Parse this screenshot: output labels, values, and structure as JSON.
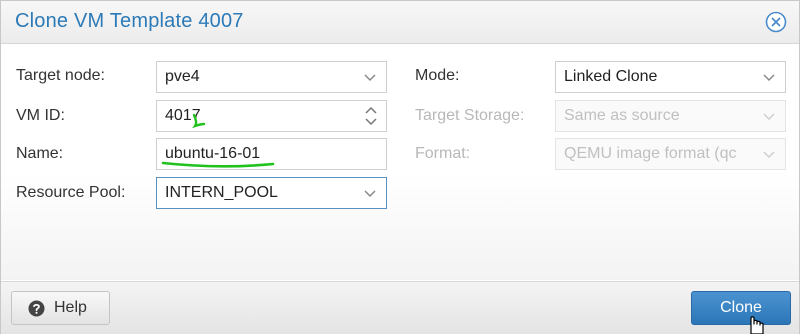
{
  "dialog": {
    "title": "Clone VM Template 4007"
  },
  "form_left": {
    "target_node": {
      "label": "Target node:",
      "value": "pve4"
    },
    "vm_id": {
      "label": "VM ID:",
      "value": "4017"
    },
    "name": {
      "label": "Name:",
      "value": "ubuntu-16-01"
    },
    "resource_pool": {
      "label": "Resource Pool:",
      "value": "INTERN_POOL"
    }
  },
  "form_right": {
    "mode": {
      "label": "Mode:",
      "value": "Linked Clone"
    },
    "target_storage": {
      "label": "Target Storage:",
      "value": "Same as source"
    },
    "format": {
      "label": "Format:",
      "value": "QEMU image format (qc"
    }
  },
  "footer": {
    "help_label": "Help",
    "clone_label": "Clone"
  },
  "colors": {
    "title": "#2c7ab7",
    "primary_button": "#2c76b8",
    "annotation_ink": "#22c21e"
  },
  "icons": {
    "close": "close-circle-icon",
    "help": "question-circle-icon",
    "dropdown": "chevron-down-icon",
    "spinner": "spinner-arrows-icon",
    "cursor": "hand-pointer-icon"
  }
}
